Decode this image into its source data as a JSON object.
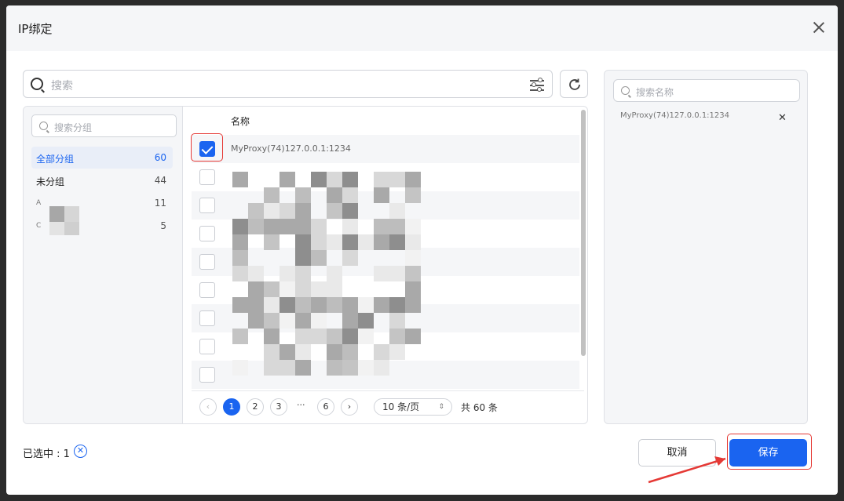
{
  "dialog": {
    "title": "IP绑定"
  },
  "search": {
    "placeholder": "搜索"
  },
  "groups": {
    "search_placeholder": "搜索分组",
    "items": [
      {
        "label": "全部分组",
        "count": "60",
        "active": true
      },
      {
        "label": "未分组",
        "count": "44"
      },
      {
        "label": "A",
        "count": "11"
      },
      {
        "label": "C",
        "count": "5"
      }
    ]
  },
  "list": {
    "header": "名称",
    "rows": [
      {
        "name": "MyProxy(74)127.0.0.1:1234",
        "checked": true
      },
      {
        "name": "",
        "checked": false
      },
      {
        "name": "",
        "checked": false
      },
      {
        "name": "",
        "checked": false
      },
      {
        "name": "",
        "checked": false
      },
      {
        "name": "",
        "checked": false
      },
      {
        "name": "",
        "checked": false
      },
      {
        "name": "",
        "checked": false
      },
      {
        "name": "",
        "checked": false
      }
    ]
  },
  "pagination": {
    "prev": "‹",
    "pages": [
      "1",
      "2",
      "3"
    ],
    "dots": "···",
    "last": "6",
    "next": "›",
    "page_size": "10 条/页",
    "total": "共 60 条"
  },
  "selected": {
    "search_placeholder": "搜索名称",
    "items": [
      {
        "name": "MyProxy(74)127.0.0.1:1234"
      }
    ]
  },
  "footer": {
    "selected_count": "已选中 : 1",
    "cancel_label": "取消",
    "save_label": "保存"
  },
  "colors": {
    "primary": "#1a64f0",
    "highlight": "#e53935"
  }
}
